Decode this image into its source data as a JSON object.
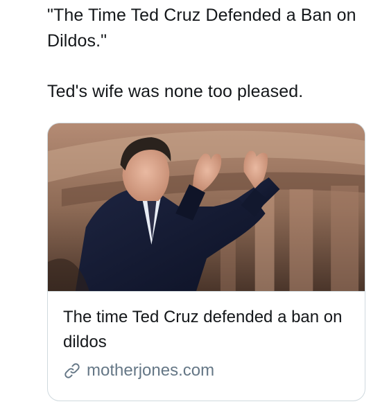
{
  "tweet": {
    "text_line_1": "\"The Time Ted Cruz Defended a Ban on Dildos.\"",
    "text_line_2": "Ted's wife was none too pleased."
  },
  "card": {
    "title": "The time Ted Cruz defended a ban on dildos",
    "domain": "motherjones.com",
    "link_icon": "link-icon"
  },
  "colors": {
    "text": "#14171a",
    "muted": "#657786",
    "border": "#cfd9de"
  }
}
